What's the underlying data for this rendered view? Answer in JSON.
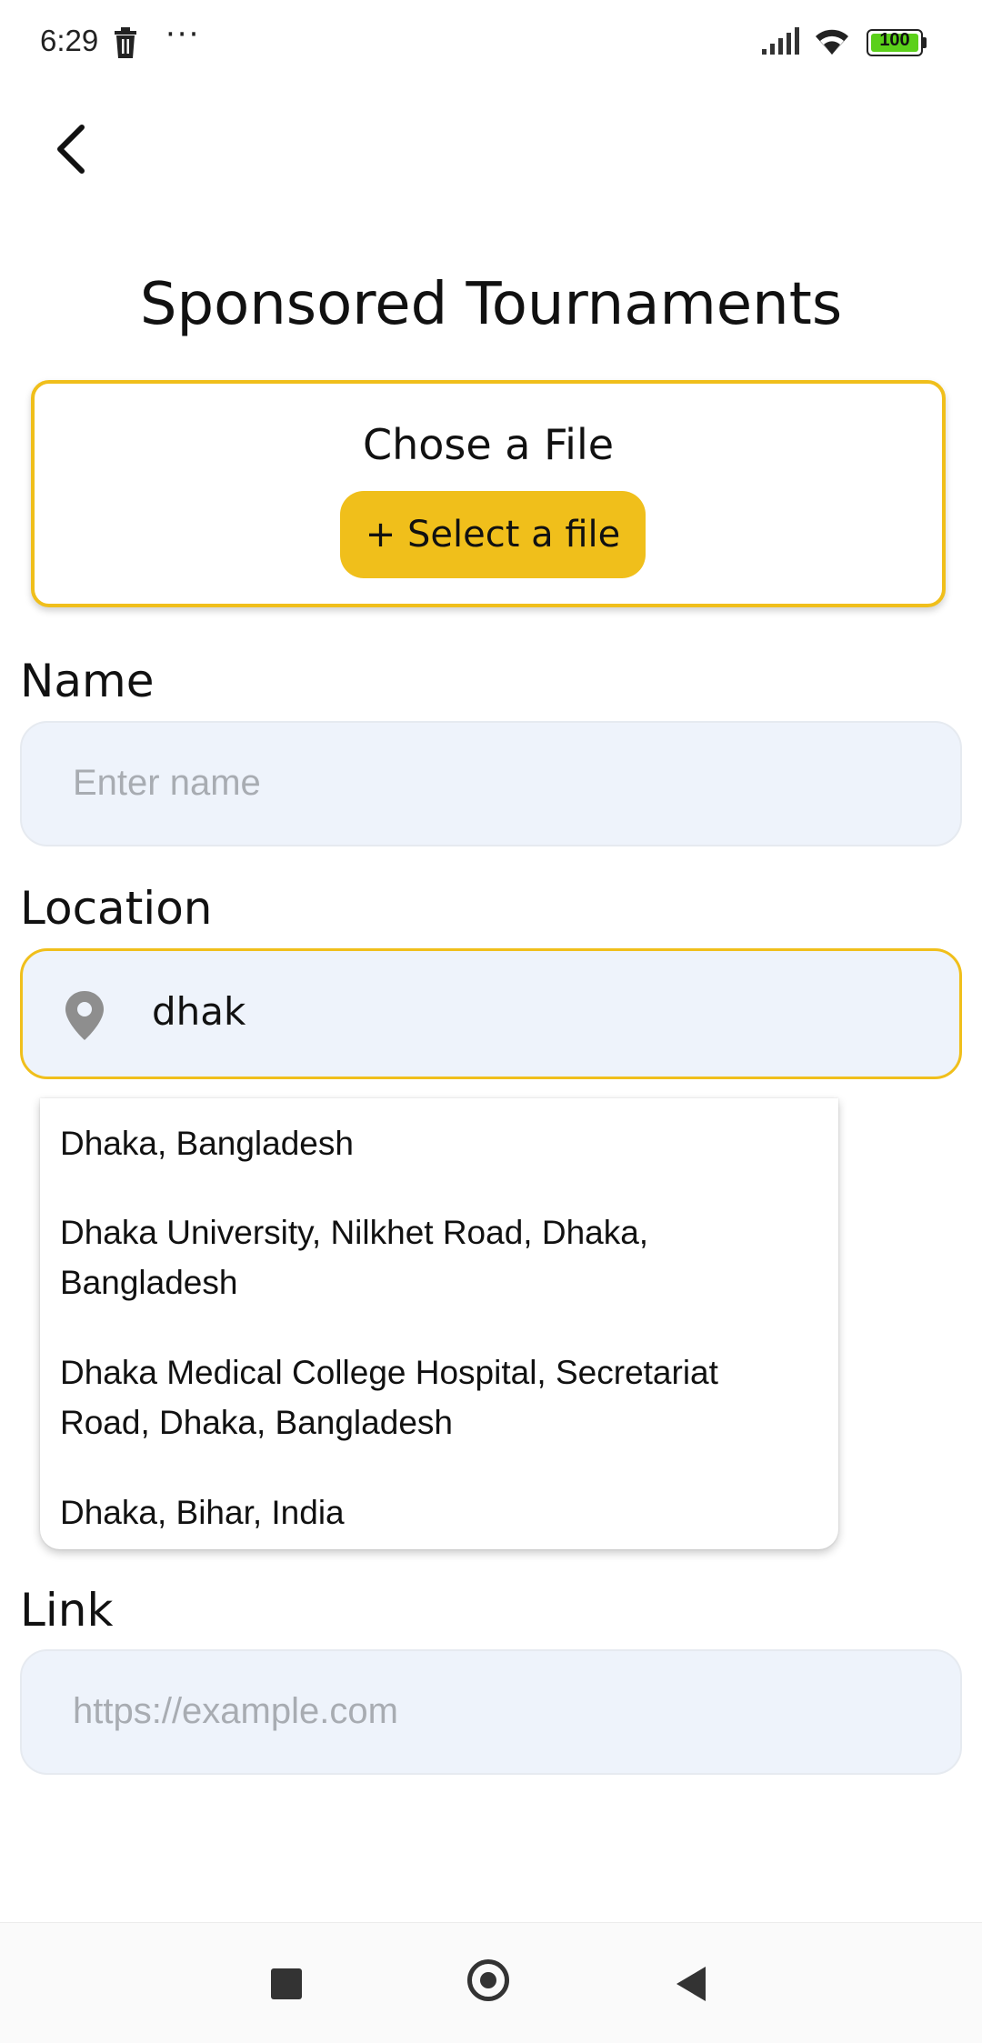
{
  "status_bar": {
    "time": "6:29",
    "more": "···",
    "battery": "100",
    "icons": [
      "trash-icon",
      "signal-icon",
      "wifi-icon",
      "battery-icon"
    ]
  },
  "header": {
    "back_icon": "chevron-left-icon",
    "title": "Sponsored Tournaments"
  },
  "file_upload": {
    "title": "Chose a File",
    "button_label": "+ Select a file"
  },
  "form": {
    "name": {
      "label": "Name",
      "placeholder": "Enter name"
    },
    "location": {
      "label": "Location",
      "value": "dhak",
      "icon": "location-pin-icon"
    },
    "link": {
      "label": "Link",
      "placeholder": "https://example.com"
    }
  },
  "suggestions": [
    "Dhaka, Bangladesh",
    "Dhaka University, Nilkhet Road, Dhaka, Bangladesh",
    "Dhaka Medical College Hospital, Secretariat Road, Dhaka, Bangladesh",
    "Dhaka, Bihar, India"
  ],
  "colors": {
    "accent": "#f0bf1b",
    "input_bg": "#eef3fb",
    "placeholder": "#a8acb2"
  },
  "nav_bar": [
    "recent-apps-icon",
    "home-icon",
    "back-triangle-icon"
  ]
}
